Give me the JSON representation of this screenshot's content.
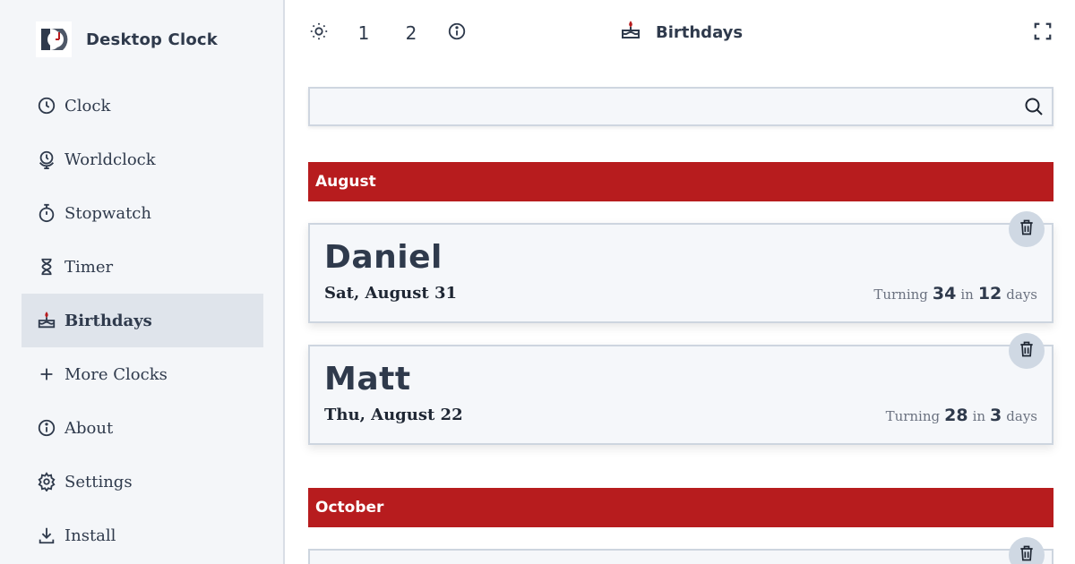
{
  "app": {
    "title": "Desktop Clock"
  },
  "sidebar": {
    "items": [
      {
        "label": "Clock",
        "icon": "clock-icon"
      },
      {
        "label": "Worldclock",
        "icon": "globe-clock-icon"
      },
      {
        "label": "Stopwatch",
        "icon": "stopwatch-icon"
      },
      {
        "label": "Timer",
        "icon": "hourglass-icon"
      },
      {
        "label": "Birthdays",
        "icon": "cake-icon",
        "active": true
      },
      {
        "label": "More Clocks",
        "icon": "plus-icon"
      },
      {
        "label": "About",
        "icon": "info-icon"
      },
      {
        "label": "Settings",
        "icon": "gear-icon"
      },
      {
        "label": "Install",
        "icon": "download-icon"
      }
    ]
  },
  "toolbar": {
    "layout_1": "1",
    "layout_2": "2",
    "title": "Birthdays"
  },
  "search": {
    "value": "",
    "placeholder": ""
  },
  "months": [
    {
      "name": "August",
      "entries": [
        {
          "name": "Daniel",
          "date": "Sat, August 31",
          "turning_label": "Turning",
          "age": "34",
          "in_label": "in",
          "days": "12",
          "days_label": "days"
        },
        {
          "name": "Matt",
          "date": "Thu, August 22",
          "turning_label": "Turning",
          "age": "28",
          "in_label": "in",
          "days": "3",
          "days_label": "days"
        }
      ]
    },
    {
      "name": "October",
      "entries": []
    }
  ],
  "colors": {
    "accent": "#b71c1e",
    "text": "#2f3a4c",
    "sidebar_bg": "#f4f6f9",
    "active_bg": "#dfe4eb"
  }
}
